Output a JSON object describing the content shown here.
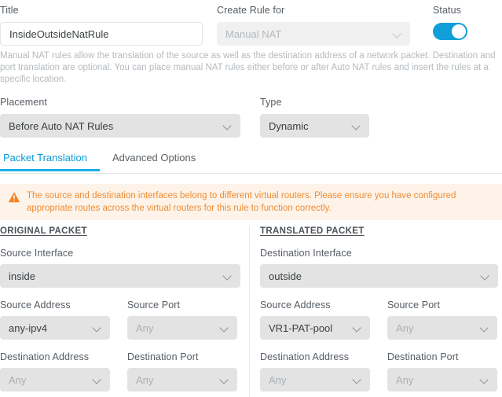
{
  "form": {
    "title": {
      "label": "Title",
      "value": "InsideOutsideNatRule",
      "placeholder": "Enter a title"
    },
    "create_rule_for": {
      "label": "Create Rule for",
      "value": "Manual NAT"
    },
    "status": {
      "label": "Status",
      "toggle_state": "on"
    },
    "description": "Manual NAT rules allow the translation of the source as well as the destination address of a network packet. Destination and port translation are optional. You can place manual NAT rules either before or after Auto NAT rules and insert the rules at a specific location.",
    "placement": {
      "label": "Placement",
      "value": "Before Auto NAT Rules"
    },
    "type": {
      "label": "Type",
      "value": "Dynamic"
    }
  },
  "tabs": [
    {
      "label": "Packet Translation",
      "active": true
    },
    {
      "label": "Advanced Options",
      "active": false
    }
  ],
  "warning": {
    "icon": "warning-triangle-icon",
    "text": "The source and destination interfaces belong to different virtual routers. Please ensure you have configured appropriate routes across the virtual routers for this rule to function correctly."
  },
  "original_packet": {
    "heading": "ORIGINAL PACKET",
    "interface": {
      "label": "Source Interface",
      "value": "inside",
      "muted": false
    },
    "source_address": {
      "label": "Source Address",
      "value": "any-ipv4",
      "muted": false
    },
    "source_port": {
      "label": "Source Port",
      "value": "Any",
      "muted": true
    },
    "destination_address": {
      "label": "Destination Address",
      "value": "Any",
      "muted": true
    },
    "destination_port": {
      "label": "Destination Port",
      "value": "Any",
      "muted": true
    }
  },
  "translated_packet": {
    "heading": "TRANSLATED PACKET",
    "interface": {
      "label": "Destination Interface",
      "value": "outside",
      "muted": false
    },
    "source_address": {
      "label": "Source Address",
      "value": "VR1-PAT-pool",
      "muted": false
    },
    "source_port": {
      "label": "Source Port",
      "value": "Any",
      "muted": true
    },
    "destination_address": {
      "label": "Destination Address",
      "value": "Any",
      "muted": true
    },
    "destination_port": {
      "label": "Destination Port",
      "value": "Any",
      "muted": true
    }
  },
  "colors": {
    "accent": "#109fd8",
    "warning_bg": "#fdf3e9",
    "warning_text": "#ef8c33",
    "control_bg": "#e3e3e3"
  }
}
